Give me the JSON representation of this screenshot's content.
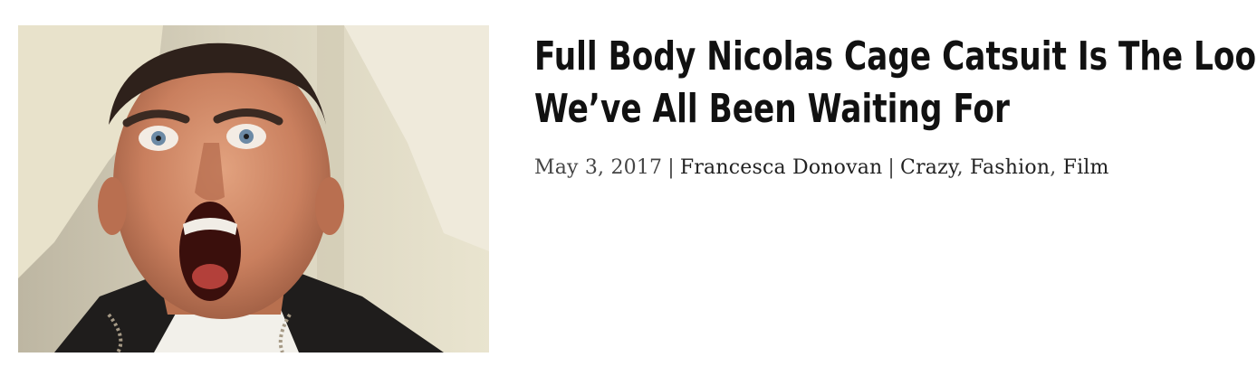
{
  "post": {
    "title_line1": "Full Body Nicolas Cage Catsuit Is The Look",
    "title_line2": "We’ve All Been Waiting For",
    "date": "May 3, 2017",
    "separator": "|",
    "author": "Francesca Donovan",
    "categories": [
      "Crazy",
      "Fashion",
      "Film"
    ],
    "category_separator": ", ",
    "thumbnail_alt": "Nicolas Cage screaming"
  }
}
